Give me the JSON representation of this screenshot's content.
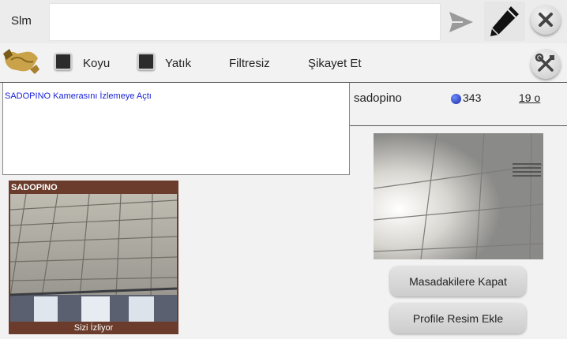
{
  "topbar": {
    "label": "Slm",
    "input_value": "",
    "send_icon": "send-icon",
    "pen_icon": "pen-icon",
    "close_icon": "close-icon"
  },
  "toolbar": {
    "handshake_icon": "handshake-icon",
    "koyu": {
      "label": "Koyu",
      "checked": true
    },
    "yatik": {
      "label": "Yatık",
      "checked": true
    },
    "filtresiz": "Filtresiz",
    "sikayet": "Şikayet Et",
    "tools_icon": "tools-icon"
  },
  "chat": {
    "messages": [
      "SADOPINO Kamerasını İzlemeye Açtı"
    ]
  },
  "user": {
    "name": "sadopino",
    "points": "343",
    "age": "19 o"
  },
  "camera": {
    "name": "SADOPINO",
    "footer": "Sizi İzliyor"
  },
  "buttons": {
    "close_table": "Masadakilere Kapat",
    "add_profile_photo": "Profile Resim Ekle"
  },
  "colors": {
    "chat_text": "#1a22d8",
    "cam_frame": "#6b3b2b",
    "points_dot": "#2a3ac8"
  }
}
